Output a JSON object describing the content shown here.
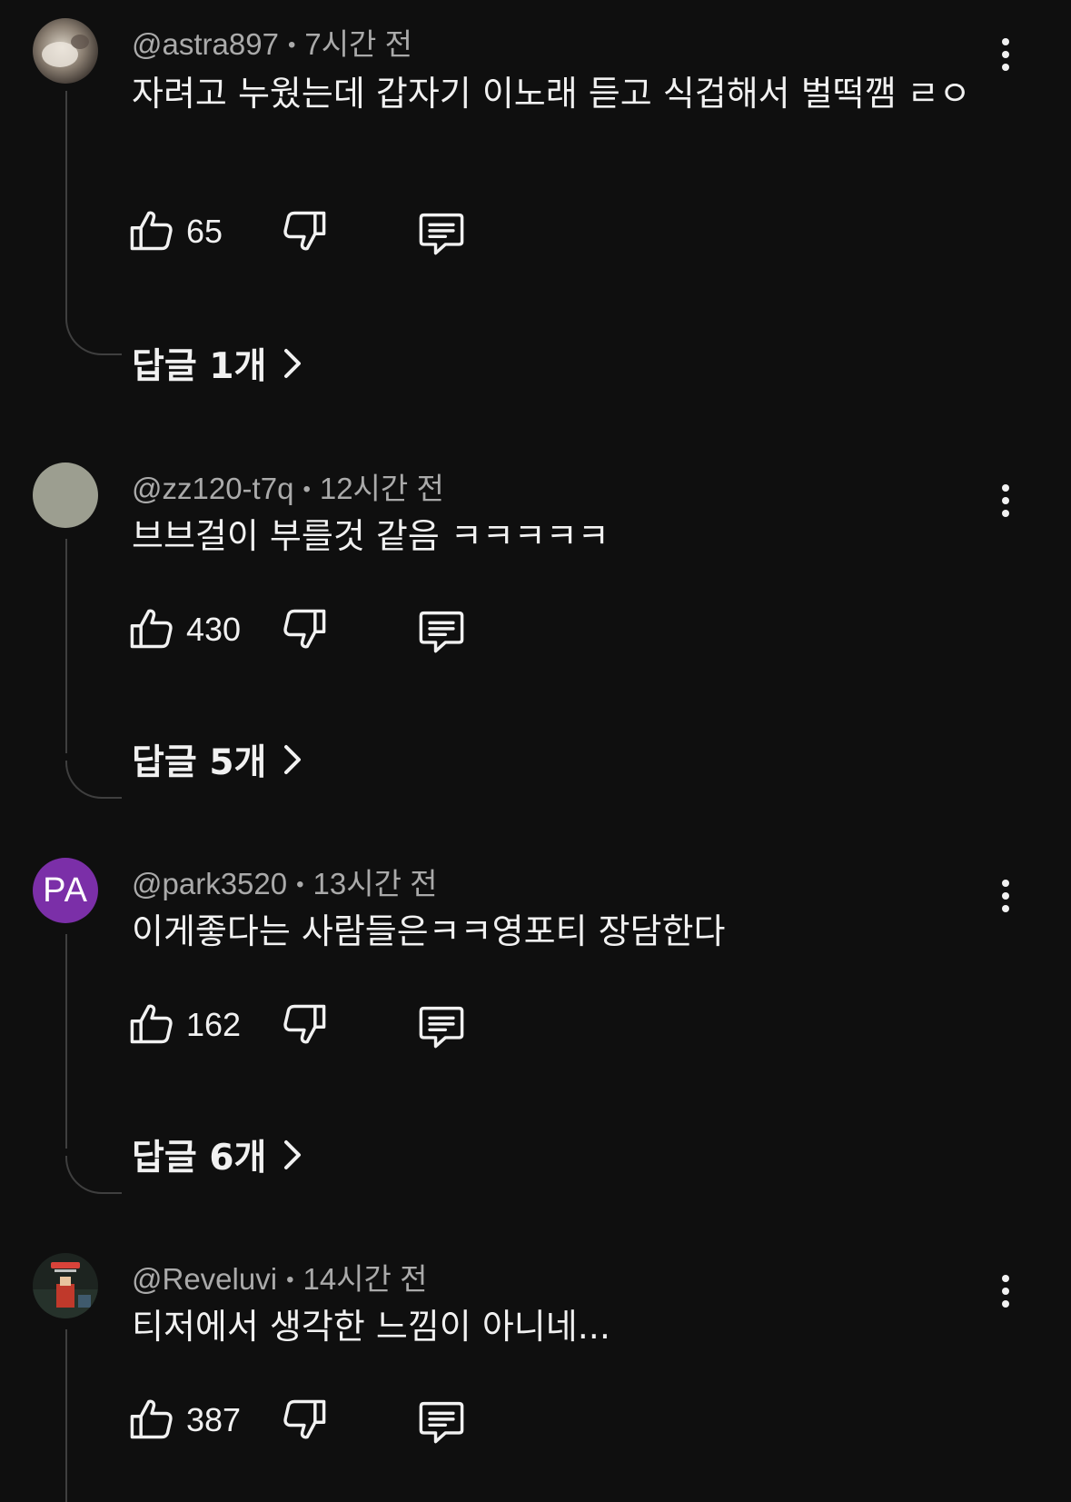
{
  "icons": {
    "like": "thumbs-up-icon",
    "dislike": "thumbs-down-icon",
    "reply": "comment-reply-icon",
    "more": "more-vertical-icon",
    "chevron": "chevron-right-icon"
  },
  "colors": {
    "background": "#0f0f0f",
    "text_primary": "#f1f1f1",
    "text_secondary": "#aaaaaa",
    "thread_line": "#3f3f3f",
    "avatar_park": "#7b2fa8",
    "avatar_zz120": "#9c9e90"
  },
  "comments": [
    {
      "author": "@astra897",
      "dot": "•",
      "time": "7시간 전",
      "text": "자려고 누웠는데 갑자기 이노래 듣고 식겁해서 벌떡깸 ㄹㅇ",
      "likes": "65",
      "replies_label": "답글 1개"
    },
    {
      "author": "@zz120-t7q",
      "dot": "•",
      "time": "12시간 전",
      "text": "브브걸이 부를것 같음 ㅋㅋㅋㅋㅋ",
      "likes": "430",
      "replies_label": "답글 5개"
    },
    {
      "author": "@park3520",
      "dot": "•",
      "time": "13시간 전",
      "avatar_initials": "PA",
      "text": "이게좋다는 사람들은ㅋㅋ영포티 장담한다",
      "likes": "162",
      "replies_label": "답글 6개"
    },
    {
      "author": "@Reveluvi",
      "dot": "•",
      "time": "14시간 전",
      "text": "티저에서 생각한 느낌이 아니네...",
      "likes": "387"
    }
  ]
}
